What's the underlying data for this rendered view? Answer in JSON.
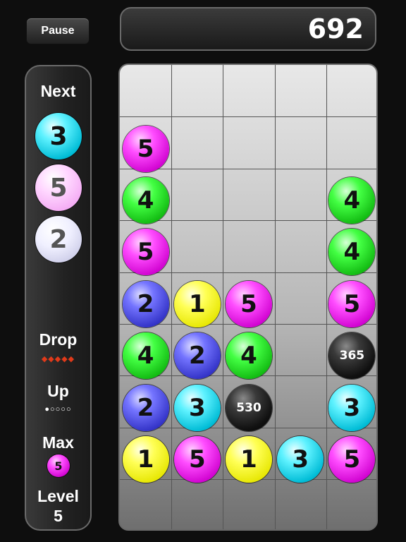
{
  "pause_label": "Pause",
  "score": "692",
  "side": {
    "next_label": "Next",
    "next": [
      {
        "value": "3",
        "color": "cyan"
      },
      {
        "value": "5",
        "color": "lpink"
      },
      {
        "value": "2",
        "color": "white"
      }
    ],
    "drop_label": "Drop",
    "drop_dots": "◆◆◆◆◆",
    "up_label": "Up",
    "up_dots": "●○○○○",
    "max_label": "Max",
    "max_value": "5",
    "level_label": "Level",
    "level_value": "5"
  },
  "board": {
    "cols": 5,
    "rows": 9,
    "balls": [
      {
        "row": 3,
        "col": 0,
        "value": "5",
        "color": "pink"
      },
      {
        "row": 4,
        "col": 0,
        "value": "4",
        "color": "green"
      },
      {
        "row": 4,
        "col": 4,
        "value": "4",
        "color": "green"
      },
      {
        "row": 5,
        "col": 0,
        "value": "5",
        "color": "pink"
      },
      {
        "row": 5,
        "col": 4,
        "value": "4",
        "color": "green"
      },
      {
        "row": 6,
        "col": 0,
        "value": "2",
        "color": "blue"
      },
      {
        "row": 6,
        "col": 1,
        "value": "1",
        "color": "yellow"
      },
      {
        "row": 6,
        "col": 2,
        "value": "5",
        "color": "pink"
      },
      {
        "row": 6,
        "col": 4,
        "value": "5",
        "color": "pink"
      },
      {
        "row": 7,
        "col": 0,
        "value": "4",
        "color": "green"
      },
      {
        "row": 7,
        "col": 1,
        "value": "2",
        "color": "blue"
      },
      {
        "row": 7,
        "col": 2,
        "value": "4",
        "color": "green"
      },
      {
        "row": 7,
        "col": 4,
        "value": "365",
        "color": "black"
      },
      {
        "row": 8,
        "col": 0,
        "value": "2",
        "color": "blue"
      },
      {
        "row": 8,
        "col": 1,
        "value": "3",
        "color": "cyan"
      },
      {
        "row": 8,
        "col": 2,
        "value": "530",
        "color": "black"
      },
      {
        "row": 8,
        "col": 4,
        "value": "3",
        "color": "cyan"
      },
      {
        "row": 9,
        "col": 0,
        "value": "1",
        "color": "yellow"
      },
      {
        "row": 9,
        "col": 1,
        "value": "5",
        "color": "pink"
      },
      {
        "row": 9,
        "col": 2,
        "value": "1",
        "color": "yellow"
      },
      {
        "row": 9,
        "col": 3,
        "value": "3",
        "color": "cyan"
      },
      {
        "row": 9,
        "col": 4,
        "value": "5",
        "color": "pink"
      }
    ]
  }
}
